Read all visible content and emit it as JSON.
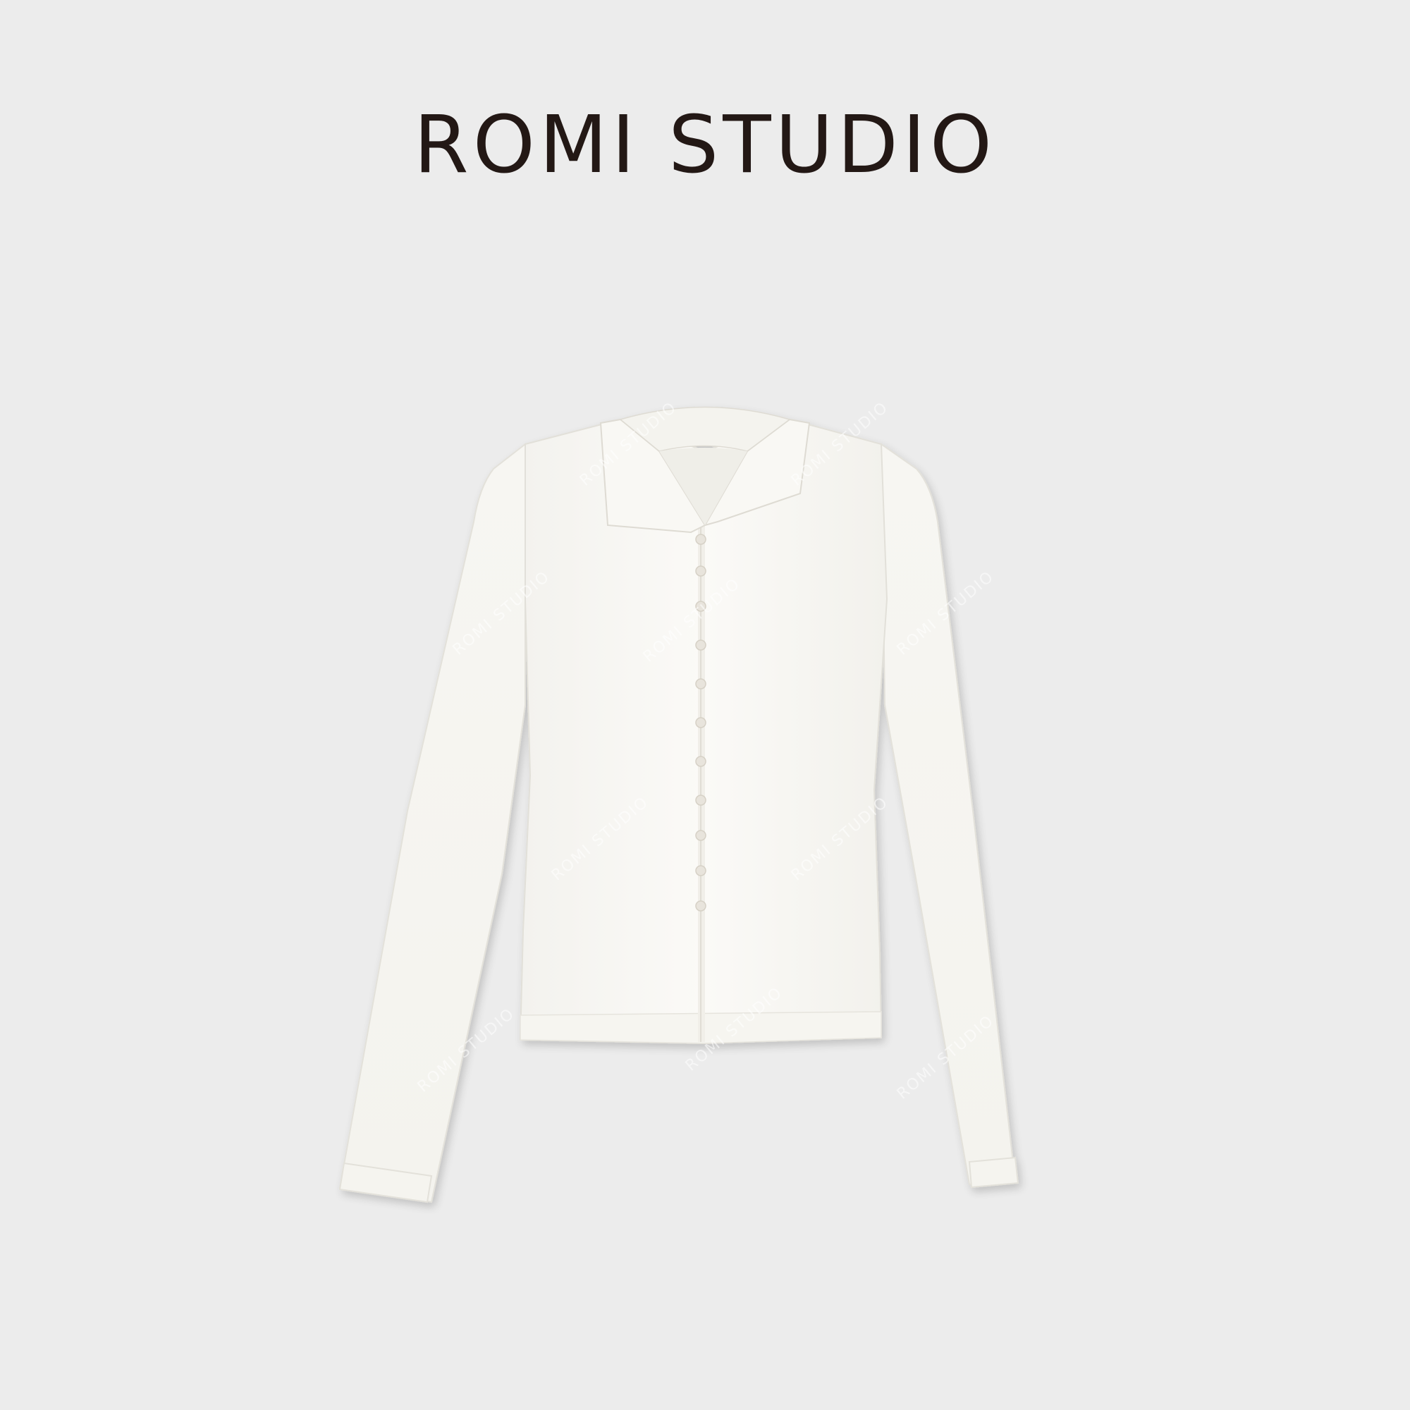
{
  "brand": {
    "name": "ROMI STUDIO"
  },
  "colors": {
    "background": "#ececec",
    "brand_text": "#231815",
    "garment": "#f9f8f4",
    "button": "#e6e2da"
  },
  "product": {
    "icon": "white-button-up-knit-cardigan",
    "button_count": 11,
    "watermark": "ROMI STUDIO"
  }
}
